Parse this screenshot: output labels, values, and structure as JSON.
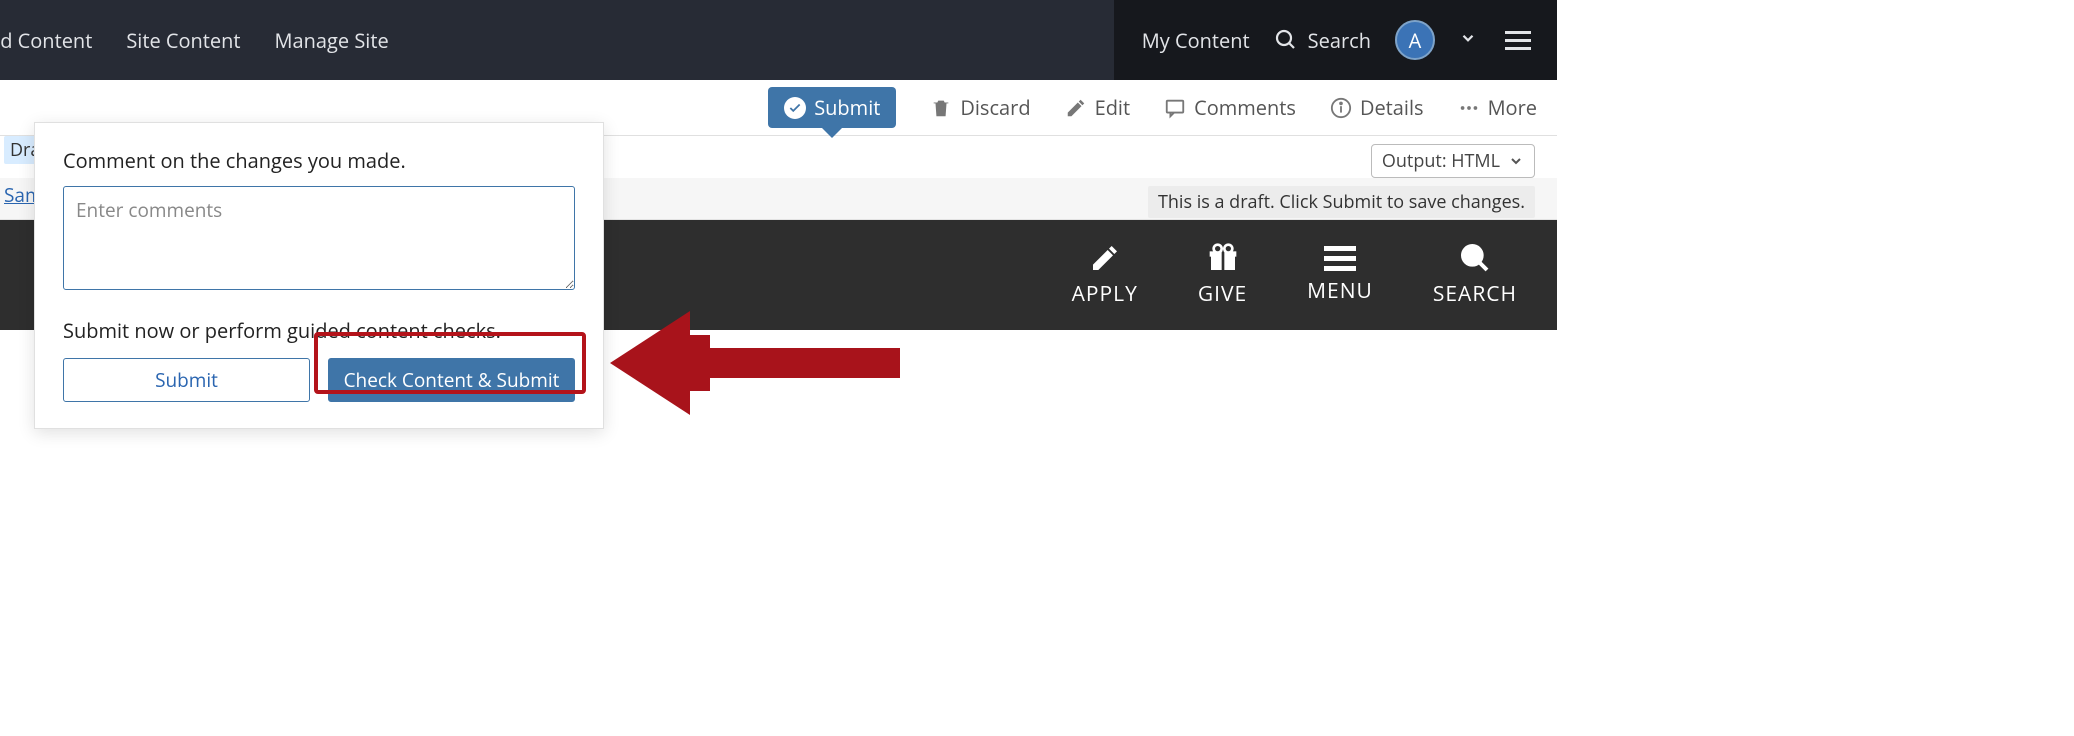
{
  "topnav": {
    "add_content": "dd Content",
    "site_content": "Site Content",
    "manage_site": "Manage Site",
    "my_content": "My Content",
    "search_label": "Search",
    "avatar_letter": "A"
  },
  "actionbar": {
    "submit": "Submit",
    "discard": "Discard",
    "edit": "Edit",
    "comments": "Comments",
    "details": "Details",
    "more": "More"
  },
  "output_select": "Output: HTML",
  "draft_banner": "This is a draft. Click Submit to save changes.",
  "sitenav": {
    "apply": "APPLY",
    "give": "GIVE",
    "menu": "MENU",
    "search": "SEARCH"
  },
  "left_edge": {
    "draft_chip": "Draft",
    "sample_link": "Sample"
  },
  "popover": {
    "comment_label": "Comment on the changes you made.",
    "comment_placeholder": "Enter comments",
    "hint": "Submit now or perform guided content checks.",
    "submit_btn": "Submit",
    "check_btn": "Check Content & Submit"
  }
}
